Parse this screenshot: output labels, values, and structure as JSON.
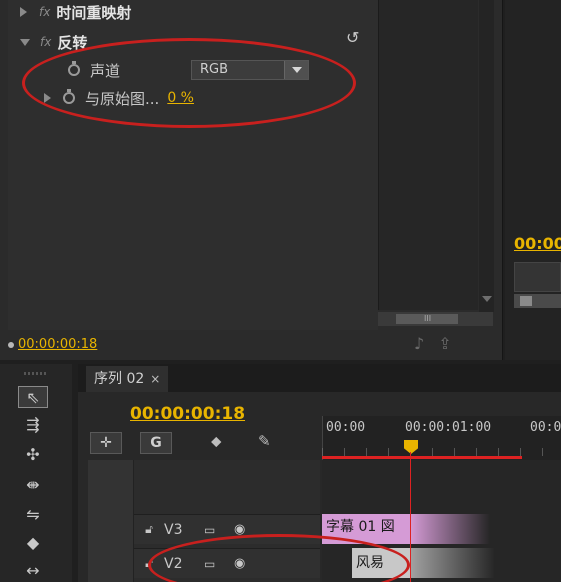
{
  "effect_controls": {
    "prev_effect_label": "时间重映射",
    "effect_tag": "fx",
    "effect_name": "反转",
    "props": [
      {
        "label": "声道",
        "value": "RGB"
      },
      {
        "label": "与原始图...",
        "value": "0 %"
      }
    ],
    "current_time": "00:00:00:18",
    "scroll_mid": "III"
  },
  "program_monitor": {
    "time": "00:00"
  },
  "timeline": {
    "tab_label": "序列 02",
    "tab_close": "×",
    "timecode": "00:00:00:18",
    "ruler_labels": [
      "00:00",
      "00:00:01:00",
      "00:0"
    ],
    "tracks": [
      {
        "name": "V3"
      },
      {
        "name": "V2"
      }
    ],
    "clips": [
      {
        "label": "字幕 01 図"
      },
      {
        "label": "风易"
      }
    ]
  },
  "colors": {
    "accent_time": "#e8b400",
    "playhead": "#d22222",
    "annotation": "#c8201e",
    "title_clip": "#d59bd6"
  },
  "icons": [
    "stopwatch-icon",
    "reset-icon",
    "selection-tool-icon",
    "track-select-icon",
    "ripple-edit-icon",
    "rolling-edit-icon",
    "rate-stretch-icon",
    "razor-icon",
    "slip-icon",
    "lock-icon",
    "toggle-output-icon",
    "eye-icon",
    "wrench-icon",
    "marker-icon",
    "snap-icon",
    "add-edit-icon"
  ]
}
